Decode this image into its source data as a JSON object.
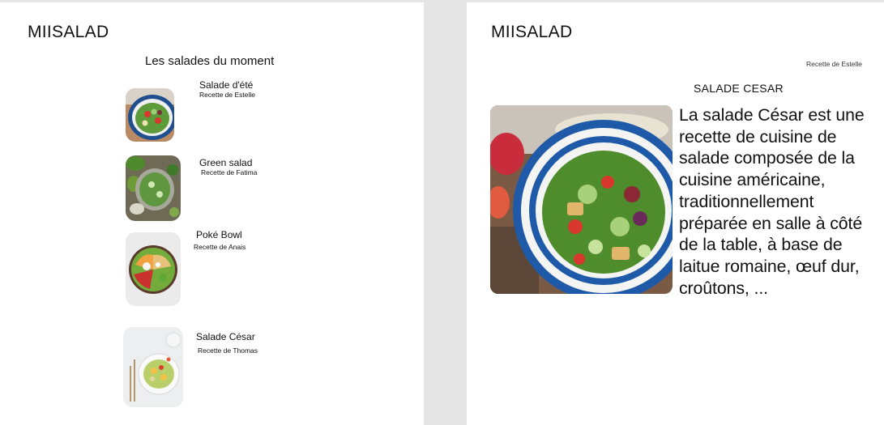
{
  "list_screen": {
    "logo": "MIISALAD",
    "section_title": "Les salades du moment",
    "items": [
      {
        "name": "Salade d'été",
        "author": "Recette de Estelle"
      },
      {
        "name": "Green salad",
        "author": "Recette de Fatima"
      },
      {
        "name": "Poké Bowl",
        "author": "Recette de Anais"
      },
      {
        "name": "Salade César",
        "author": "Recette de Thomas"
      }
    ]
  },
  "detail_screen": {
    "logo": "MIISALAD",
    "author": "Recette de Estelle",
    "title": "SALADE CESAR",
    "description": "La salade César est une recette de cuisine de salade composée de la cuisine américaine, traditionnellement préparée en salle à côté de la table, à base de laitue romaine, œuf dur, croûtons, ..."
  }
}
